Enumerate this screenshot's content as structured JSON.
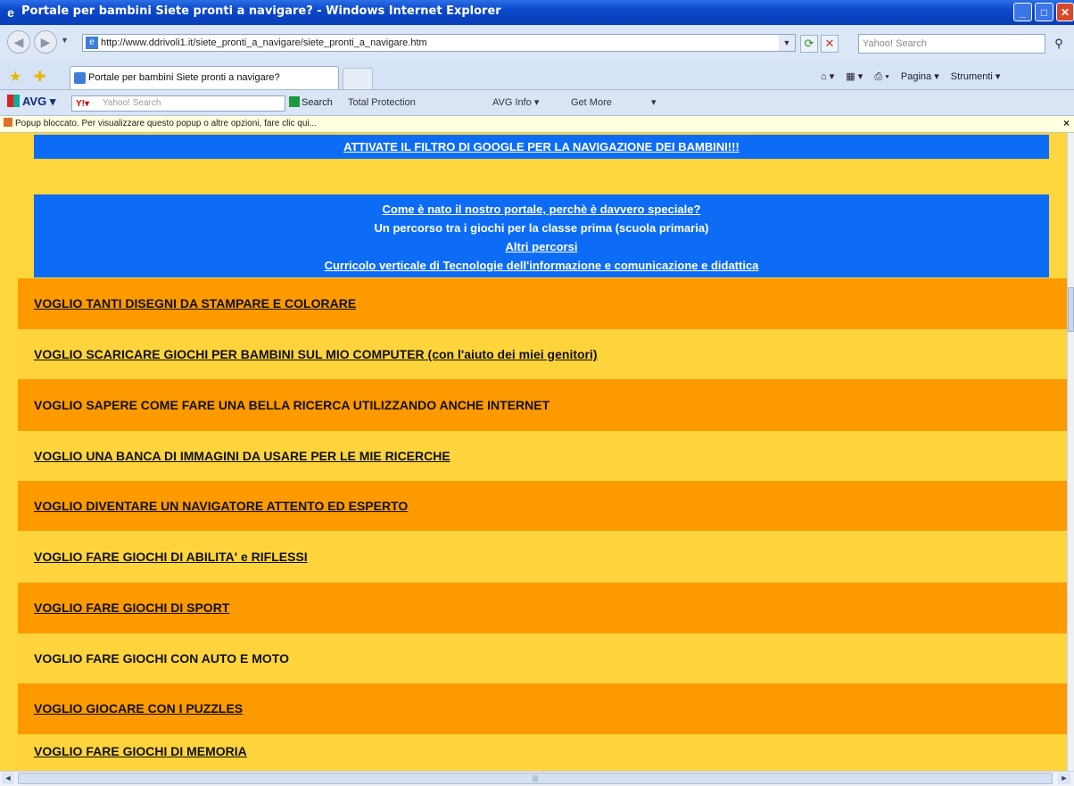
{
  "window": {
    "title": "Portale per bambini Siete pronti a navigare? - Windows Internet Explorer",
    "min": "_",
    "max": "□",
    "close": "✕"
  },
  "address": {
    "url": "http://www.ddrivoli1.it/siete_pronti_a_navigare/siete_pronti_a_navigare.htm",
    "search_placeholder": "Yahoo! Search"
  },
  "tabs": [
    {
      "label": "Portale per bambini Siete pronti a navigare?"
    }
  ],
  "commandbar": {
    "home": "⌂ ▾",
    "feeds": "▦ ▾",
    "print": "⎙ ▾",
    "page": "Pagina ▾",
    "tools": "Strumenti ▾"
  },
  "avg": {
    "logo": "AVG",
    "search_placeholder": "Yahoo! Search",
    "search_btn": "Search",
    "items": [
      "Total Protection",
      "AVG Info ▾",
      "Get More",
      "▾"
    ]
  },
  "infobar": {
    "text": "Popup bloccato. Per visualizzare questo popup o altre opzioni, fare clic qui..."
  },
  "content": {
    "top_banner": "ATTIVATE IL FILTRO DI GOOGLE PER LA NAVIGAZIONE DEI BAMBINI!!!",
    "box_lines": [
      {
        "text": "Come è nato il nostro portale, perchè è davvero speciale?",
        "link": true
      },
      {
        "text": "Un percorso tra i giochi per la classe prima (scuola primaria)",
        "link": false
      },
      {
        "text": "Altri percorsi",
        "link": true
      },
      {
        "text": "Curricolo verticale di Tecnologie dell'informazione e comunicazione e didattica",
        "link": true
      }
    ],
    "rows": [
      {
        "text": "VOGLIO TANTI DISEGNI DA STAMPARE E COLORARE",
        "extra": "",
        "link": true,
        "color": "#fd9a00"
      },
      {
        "text": "VOGLIO SCARICARE GIOCHI PER BAMBINI SUL MIO COMPUTER",
        "extra": " (con l'aiuto dei miei genitori)",
        "link": true,
        "color": "#fed43d"
      },
      {
        "text": "VOGLIO SAPERE COME FARE UNA BELLA RICERCA UTILIZZANDO ANCHE INTERNET",
        "extra": "",
        "link": false,
        "color": "#fd9a00"
      },
      {
        "text": "VOGLIO UNA BANCA DI IMMAGINI DA USARE PER LE MIE RICERCHE",
        "extra": "",
        "link": true,
        "color": "#fed43d"
      },
      {
        "text": "VOGLIO DIVENTARE UN NAVIGATORE ATTENTO ED ESPERTO",
        "extra": "",
        "link": true,
        "color": "#fd9a00"
      },
      {
        "text": "VOGLIO FARE GIOCHI DI ABILITA' e RIFLESSI",
        "extra": "",
        "link": true,
        "color": "#fed43d"
      },
      {
        "text": "VOGLIO FARE GIOCHI DI SPORT",
        "extra": "",
        "link": true,
        "color": "#fd9a00"
      },
      {
        "text": "VOGLIO FARE GIOCHI CON AUTO E MOTO",
        "extra": "",
        "link": false,
        "color": "#fed43d"
      },
      {
        "text": "VOGLIO GIOCARE CON I PUZZLES",
        "extra": "",
        "link": true,
        "color": "#fd9a00"
      },
      {
        "text": "VOGLIO FARE GIOCHI DI MEMORIA",
        "extra": "",
        "link": true,
        "color": "#fed43d"
      }
    ]
  },
  "scroll": {
    "h_grip": "|||",
    "left": "◄",
    "right": "►"
  }
}
